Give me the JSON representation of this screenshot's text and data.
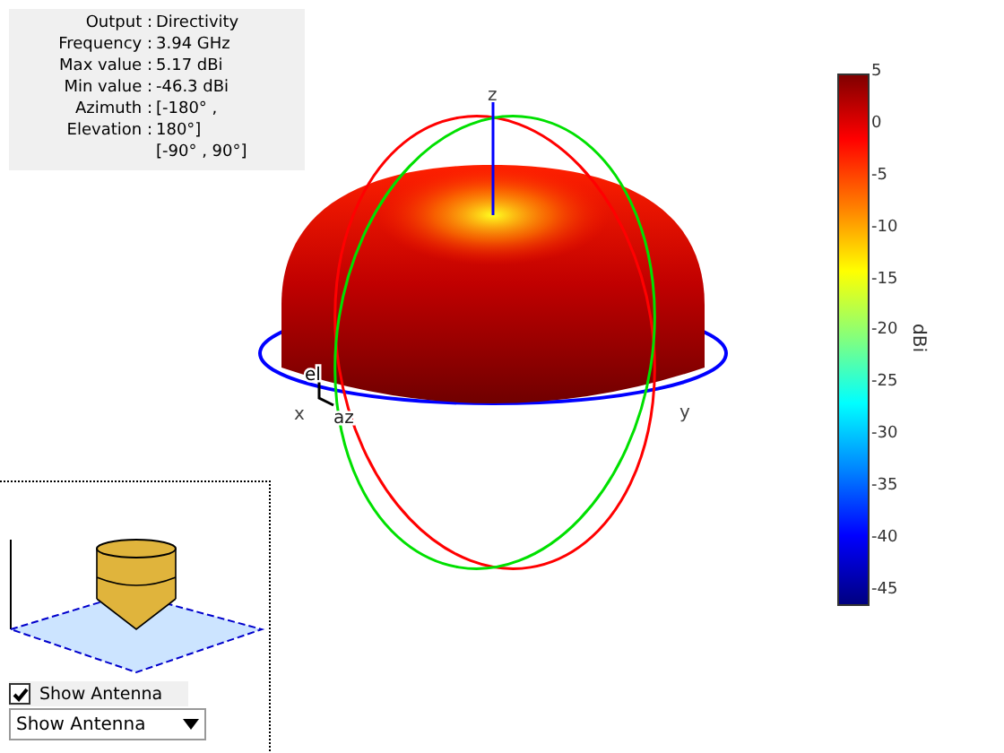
{
  "info": [
    {
      "label": "Output :",
      "value": "Directivity"
    },
    {
      "label": "Frequency :",
      "value": "3.94 GHz"
    },
    {
      "label": "Max value :",
      "value": "5.17 dBi"
    },
    {
      "label": "Min value :",
      "value": "-46.3 dBi"
    },
    {
      "label": "Azimuth :",
      "value": "[-180° ,"
    },
    {
      "label": "Elevation :",
      "value": "180°]"
    },
    {
      "value": "[-90° , 90°]"
    }
  ],
  "plot": {
    "axis_labels": {
      "z": "z",
      "x": "x",
      "y": "y",
      "el": "el",
      "az": "az"
    }
  },
  "colorbar": {
    "label": "dBi",
    "ticks": [
      "5",
      "0",
      "-5",
      "-10",
      "-15",
      "-20",
      "-25",
      "-30",
      "-35",
      "-40",
      "-45"
    ]
  },
  "antenna_view": {
    "show_antenna": {
      "label": "Show Antenna",
      "checked": true
    },
    "dropdown": {
      "value": "Show Antenna"
    }
  }
}
